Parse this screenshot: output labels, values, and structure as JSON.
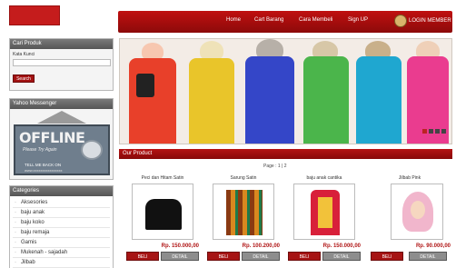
{
  "nav": {
    "items": [
      "Home",
      "Cart Barang",
      "Cara Membeli",
      "Sign UP"
    ],
    "login_label": "LOGIN MEMBER"
  },
  "search": {
    "heading": "Cari Produk",
    "label": "Kata Kunci",
    "value": "",
    "button_label": "Search"
  },
  "yahoo": {
    "heading": "Yahoo Messenger",
    "status": "OFFLINE",
    "sub": "Please Try Again",
    "footer1": "TELL ME BACK ON",
    "footer2": "www.xxxxxxxxxxxxxxxx"
  },
  "categories": {
    "heading": "Categories",
    "items": [
      "Aksesories",
      "baju anak",
      "baju koko",
      "baju remaja",
      "Gamis",
      "Mukenah - sajadah",
      "Jilbab"
    ]
  },
  "banner": {
    "colors": [
      "#e8402a",
      "#e9c52a",
      "#3446c8",
      "#4bb54b",
      "#1fa7d0",
      "#ea3c8f"
    ]
  },
  "products": {
    "heading": "Our Product",
    "pager": "Page : 1 | 2",
    "items": [
      {
        "name": "Peci dan Hitam Satin",
        "price": "Rp. 150.000,00"
      },
      {
        "name": "Sarung Satin",
        "price": "Rp. 100.200,00"
      },
      {
        "name": "baju anak cantika",
        "price": "Rp. 150.000,00"
      },
      {
        "name": "Jilbab Pink",
        "price": "Rp. 90.000,00"
      }
    ],
    "buy_label": "BELI",
    "detail_label": "DETAIL"
  }
}
